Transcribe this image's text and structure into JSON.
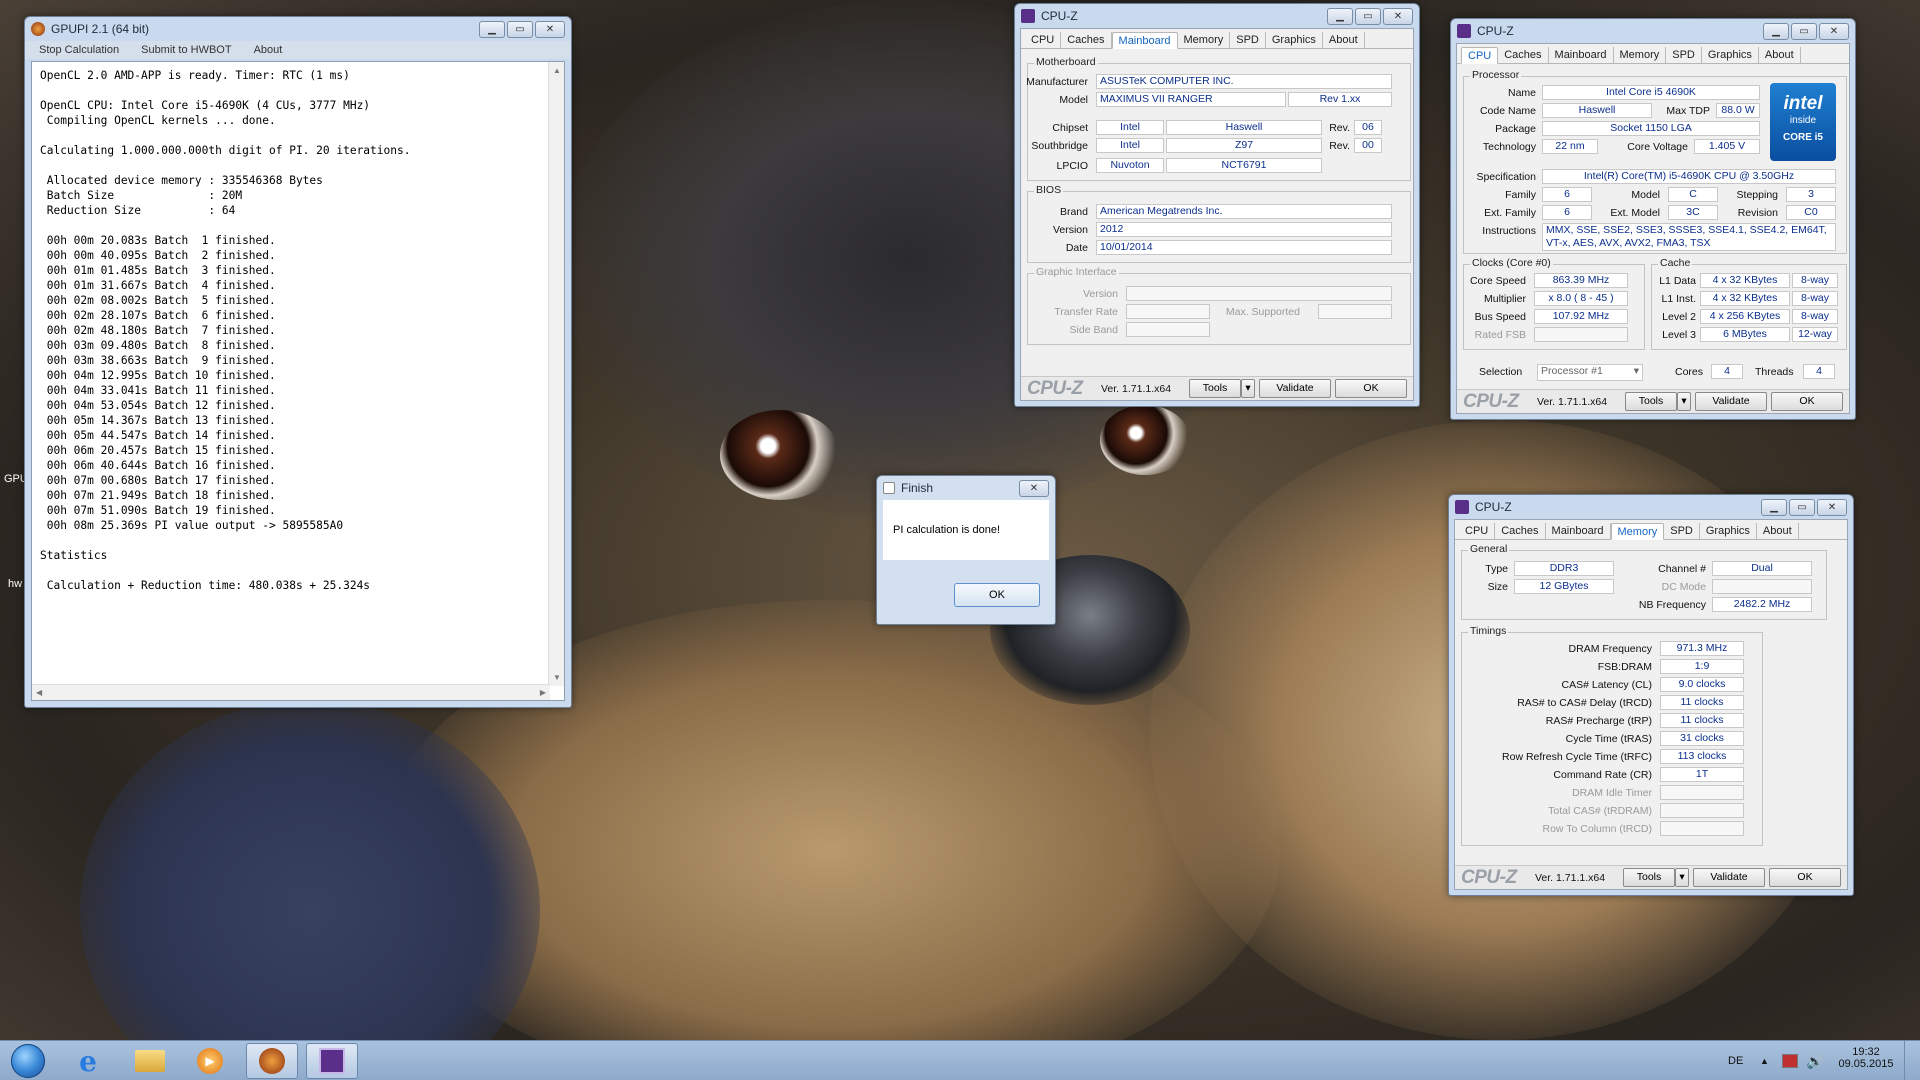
{
  "desktop": {
    "edge_labels": [
      "GPU",
      "hw"
    ]
  },
  "gpupi": {
    "title": "GPUPI 2.1 (64 bit)",
    "menu": [
      "Stop Calculation",
      "Submit to HWBOT",
      "About"
    ],
    "console": "OpenCL 2.0 AMD-APP is ready. Timer: RTC (1 ms)\n\nOpenCL CPU: Intel Core i5-4690K (4 CUs, 3777 MHz)\n Compiling OpenCL kernels ... done.\n\nCalculating 1.000.000.000th digit of PI. 20 iterations.\n\n Allocated device memory : 335546368 Bytes\n Batch Size              : 20M\n Reduction Size          : 64\n\n 00h 00m 20.083s Batch  1 finished.\n 00h 00m 40.095s Batch  2 finished.\n 00h 01m 01.485s Batch  3 finished.\n 00h 01m 31.667s Batch  4 finished.\n 00h 02m 08.002s Batch  5 finished.\n 00h 02m 28.107s Batch  6 finished.\n 00h 02m 48.180s Batch  7 finished.\n 00h 03m 09.480s Batch  8 finished.\n 00h 03m 38.663s Batch  9 finished.\n 00h 04m 12.995s Batch 10 finished.\n 00h 04m 33.041s Batch 11 finished.\n 00h 04m 53.054s Batch 12 finished.\n 00h 05m 14.367s Batch 13 finished.\n 00h 05m 44.547s Batch 14 finished.\n 00h 06m 20.457s Batch 15 finished.\n 00h 06m 40.644s Batch 16 finished.\n 00h 07m 00.680s Batch 17 finished.\n 00h 07m 21.949s Batch 18 finished.\n 00h 07m 51.090s Batch 19 finished.\n 00h 08m 25.369s PI value output -> 5895585A0\n\nStatistics\n\n Calculation + Reduction time: 480.038s + 25.324s"
  },
  "cpuz_common": {
    "title": "CPU-Z",
    "tabs": [
      "CPU",
      "Caches",
      "Mainboard",
      "Memory",
      "SPD",
      "Graphics",
      "About"
    ],
    "logo": "CPU-Z",
    "version": "Ver. 1.71.1.x64",
    "tools": "Tools",
    "validate": "Validate",
    "ok": "OK"
  },
  "mainboard": {
    "motherboard_title": "Motherboard",
    "manufacturer_label": "Manufacturer",
    "manufacturer": "ASUSTeK COMPUTER INC.",
    "model_label": "Model",
    "model": "MAXIMUS VII RANGER",
    "model_rev": "Rev 1.xx",
    "chipset_label": "Chipset",
    "chipset_vendor": "Intel",
    "chipset": "Haswell",
    "rev_label": "Rev.",
    "chipset_rev": "06",
    "southbridge_label": "Southbridge",
    "sb_vendor": "Intel",
    "sb": "Z97",
    "sb_rev": "00",
    "lpcio_label": "LPCIO",
    "lpcio_vendor": "Nuvoton",
    "lpcio": "NCT6791",
    "bios_title": "BIOS",
    "brand_label": "Brand",
    "brand": "American Megatrends Inc.",
    "version_label": "Version",
    "version": "2012",
    "date_label": "Date",
    "date": "10/01/2014",
    "gi_title": "Graphic Interface",
    "gi_version": "Version",
    "gi_transfer": "Transfer Rate",
    "gi_max": "Max. Supported",
    "gi_sideband": "Side Band"
  },
  "cpu": {
    "processor_title": "Processor",
    "name_label": "Name",
    "name": "Intel Core i5 4690K",
    "codename_label": "Code Name",
    "codename": "Haswell",
    "tdp_label": "Max TDP",
    "tdp": "88.0 W",
    "package_label": "Package",
    "package": "Socket 1150 LGA",
    "tech_label": "Technology",
    "tech": "22 nm",
    "voltage_label": "Core Voltage",
    "voltage": "1.405 V",
    "spec_label": "Specification",
    "spec": "Intel(R) Core(TM) i5-4690K CPU @ 3.50GHz",
    "family_label": "Family",
    "family": "6",
    "model_label": "Model",
    "model": "C",
    "stepping_label": "Stepping",
    "stepping": "3",
    "extfamily_label": "Ext. Family",
    "extfamily": "6",
    "extmodel_label": "Ext. Model",
    "extmodel": "3C",
    "revision_label": "Revision",
    "revision": "C0",
    "instr_label": "Instructions",
    "instr1": "MMX, SSE, SSE2, SSE3, SSSE3, SSE4.1, SSE4.2, EM64T,",
    "instr2": "VT-x, AES, AVX, AVX2, FMA3, TSX",
    "clocks_title": "Clocks (Core #0)",
    "corespeed_label": "Core Speed",
    "corespeed": "863.39 MHz",
    "mult_label": "Multiplier",
    "mult": "x 8.0 ( 8 - 45 )",
    "bus_label": "Bus Speed",
    "bus": "107.92 MHz",
    "fsb_label": "Rated FSB",
    "cache_title": "Cache",
    "l1d_label": "L1 Data",
    "l1d": "4 x 32 KBytes",
    "l1d_way": "8-way",
    "l1i_label": "L1 Inst.",
    "l1i": "4 x 32 KBytes",
    "l1i_way": "8-way",
    "l2_label": "Level 2",
    "l2": "4 x 256 KBytes",
    "l2_way": "8-way",
    "l3_label": "Level 3",
    "l3": "6 MBytes",
    "l3_way": "12-way",
    "selection_label": "Selection",
    "selection": "Processor #1",
    "cores_label": "Cores",
    "cores": "4",
    "threads_label": "Threads",
    "threads": "4",
    "intel_logo": {
      "line1": "intel",
      "line2": "inside",
      "line3": "CORE i5"
    }
  },
  "memory": {
    "general_title": "General",
    "type_label": "Type",
    "type": "DDR3",
    "size_label": "Size",
    "size": "12 GBytes",
    "channel_label": "Channel #",
    "channel": "Dual",
    "dcmode_label": "DC Mode",
    "nbfreq_label": "NB Frequency",
    "nbfreq": "2482.2 MHz",
    "timings_title": "Timings",
    "timings": [
      {
        "label": "DRAM Frequency",
        "value": "971.3 MHz"
      },
      {
        "label": "FSB:DRAM",
        "value": "1:9"
      },
      {
        "label": "CAS# Latency (CL)",
        "value": "9.0 clocks"
      },
      {
        "label": "RAS# to CAS# Delay (tRCD)",
        "value": "11 clocks"
      },
      {
        "label": "RAS# Precharge (tRP)",
        "value": "11 clocks"
      },
      {
        "label": "Cycle Time (tRAS)",
        "value": "31 clocks"
      },
      {
        "label": "Row Refresh Cycle Time (tRFC)",
        "value": "113 clocks"
      },
      {
        "label": "Command Rate (CR)",
        "value": "1T"
      },
      {
        "label": "DRAM Idle Timer",
        "value": ""
      },
      {
        "label": "Total CAS# (tRDRAM)",
        "value": ""
      },
      {
        "label": "Row To Column (tRCD)",
        "value": ""
      }
    ]
  },
  "finish": {
    "title": "Finish",
    "message": "PI calculation is done!",
    "ok": "OK"
  },
  "taskbar": {
    "lang": "DE",
    "time": "19:32",
    "date": "09.05.2015"
  },
  "colors": {
    "accent": "#1565c0",
    "value_text": "#0b2f8c",
    "taskbar": "#9bb6d6"
  }
}
